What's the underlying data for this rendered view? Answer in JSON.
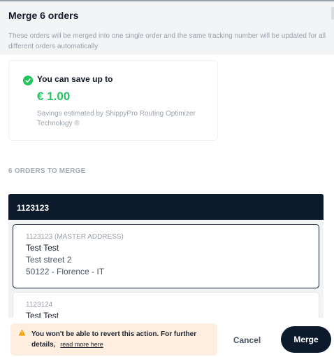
{
  "modal": {
    "title": "Merge 6 orders",
    "description": "These orders will be merged into one single order and the same tracking number will be updated for all different orders automatically"
  },
  "savings": {
    "icon": "check-circle-icon",
    "title": "You can save up to",
    "amount": "€ 1.00",
    "note": "Savings estimated by ShippyPro Routing Optimizer Technology ®",
    "accent_color": "#22c55e"
  },
  "orders_section": {
    "title": "6 ORDERS TO MERGE",
    "group": {
      "header": "1123123",
      "orders": [
        {
          "id": "1123123 (MASTER ADDRESS)",
          "name": "Test Test",
          "street": "Test street 2",
          "city": "50122 - Florence - IT"
        },
        {
          "id": "1123124",
          "name": "Test Test"
        }
      ]
    }
  },
  "footer": {
    "warning_icon": "warning-triangle-icon",
    "warning_text": "You won't be able to revert this action. For further details,",
    "warning_link": "read more here",
    "cancel_label": "Cancel",
    "merge_label": "Merge",
    "warning_bg": "#fdeee0",
    "primary_color": "#0c1a2b"
  }
}
